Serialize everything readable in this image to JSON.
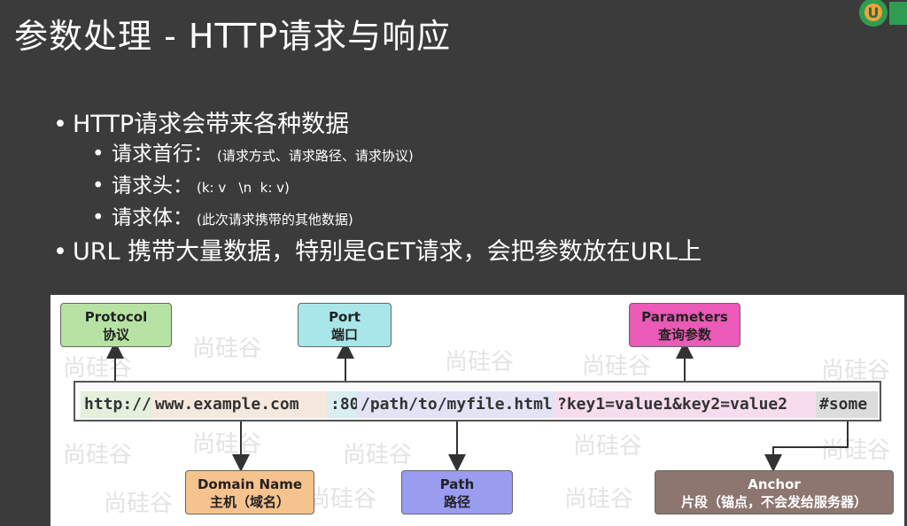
{
  "title": "参数处理 - HTTP请求与响应",
  "bullets": {
    "b1": "HTTP请求会带来各种数据",
    "sub": [
      {
        "label": "请求首行：",
        "note": "(请求方式、请求路径、请求协议)"
      },
      {
        "label": "请求头：",
        "note": "(k: v   \\n  k: v)"
      },
      {
        "label": "请求体：",
        "note": "(此次请求携带的其他数据)"
      }
    ],
    "b2": "URL 携带大量数据，特别是GET请求，会把参数放在URL上"
  },
  "diagram": {
    "url_segments": [
      {
        "text": "http://",
        "color": "#e3f0dc"
      },
      {
        "text": "www.example.com",
        "color": "#f5e8dc"
      },
      {
        "text": ":80",
        "color": "#d9eef0"
      },
      {
        "text": "/path/to/myfile.html",
        "color": "#e2e4f6"
      },
      {
        "text": "?key1=value1&key2=value2",
        "color": "#f6dcec"
      },
      {
        "text": "#some",
        "color": "#dcdcdc"
      }
    ],
    "boxes": {
      "protocol": {
        "en": "Protocol",
        "cn": "协议",
        "color": "#b6e3a4"
      },
      "port": {
        "en": "Port",
        "cn": "端口",
        "color": "#a8e6ea"
      },
      "parameters": {
        "en": "Parameters",
        "cn": "查询参数",
        "color": "#ea5ab6"
      },
      "domain": {
        "en": "Domain Name",
        "cn": "主机（域名）",
        "color": "#f6c28e"
      },
      "path": {
        "en": "Path",
        "cn": "路径",
        "color": "#9a9cf0"
      },
      "anchor": {
        "en": "Anchor",
        "cn": "片段（锚点，不会发给服务器）",
        "color": "#8e7670"
      }
    },
    "watermark": "尚硅谷"
  }
}
